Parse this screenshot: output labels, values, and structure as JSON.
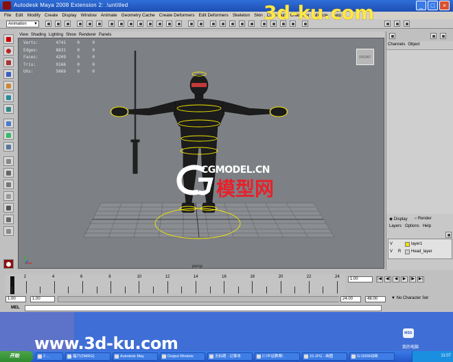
{
  "window": {
    "title": "Autodesk Maya 2008 Extension 2: .\\untitled",
    "min_glyph": "_",
    "max_glyph": "□",
    "close_glyph": "×"
  },
  "menubar": [
    "File",
    "Edit",
    "Modify",
    "Create",
    "Display",
    "Window",
    "Animate",
    "Geometry Cache",
    "Create Deformers",
    "Edit Deformers",
    "Skeleton",
    "Skin",
    "Constrain",
    "Character",
    "Muscle",
    "Help"
  ],
  "shelf": {
    "mode": "Animation"
  },
  "panel_menu": [
    "View",
    "Shading",
    "Lighting",
    "Show",
    "Renderer",
    "Panels"
  ],
  "hud": [
    {
      "label": "Verts:",
      "v1": "4741",
      "v2": "0",
      "v3": "0"
    },
    {
      "label": "Edges:",
      "v1": "8831",
      "v2": "0",
      "v3": "0"
    },
    {
      "label": "Faces:",
      "v1": "4209",
      "v2": "0",
      "v3": "0"
    },
    {
      "label": "Tris:",
      "v1": "9166",
      "v2": "0",
      "v3": "0"
    },
    {
      "label": "UVs:",
      "v1": "5069",
      "v2": "0",
      "v3": "0"
    }
  ],
  "viewport": {
    "viewcube": "FRONT",
    "camera": "persp"
  },
  "watermark": {
    "en": "CGMODEL.CN",
    "cn": "模型网"
  },
  "site_watermark_top": "3d-ku.com",
  "site_watermark_bottom": "www.3d-ku.com",
  "channel_box": {
    "menu": [
      "Channels",
      "Object"
    ],
    "display_radio": "Display",
    "render_radio": "Render",
    "layer_menu": [
      "Layers",
      "Options",
      "Help"
    ],
    "layers": [
      {
        "v": "V",
        "r": "",
        "name": "layer1",
        "color": "#f2e000"
      },
      {
        "v": "V",
        "r": "R",
        "name": "Head_layer",
        "color": "#d0d0d0"
      }
    ]
  },
  "timeline": {
    "ticks": [
      "2",
      "4",
      "6",
      "8",
      "10",
      "12",
      "14",
      "16",
      "18",
      "20",
      "22",
      "24"
    ],
    "current_frame": "1.00",
    "playback": [
      "|◀",
      "◀|",
      "◀",
      "▶",
      "|▶",
      "▶|"
    ]
  },
  "range": {
    "start": "1.00",
    "play_start": "1.00",
    "play_end": "24.00",
    "end": "48.00",
    "character_set": "No Character Set"
  },
  "cmdline": {
    "label": "MEL"
  },
  "desktop": {
    "msg_icon": "MSG",
    "computer_label": "我的电脑"
  },
  "taskbar": {
    "start": "开始",
    "tasks": [
      "2 ...",
      "福介(DMRG)",
      "Autodesk May",
      "Output Window",
      "无标题 - 记事本",
      "C:\\中话教案\\",
      "10.JPG - 画图",
      "G:\\2009动画"
    ],
    "clock": "11:07"
  }
}
